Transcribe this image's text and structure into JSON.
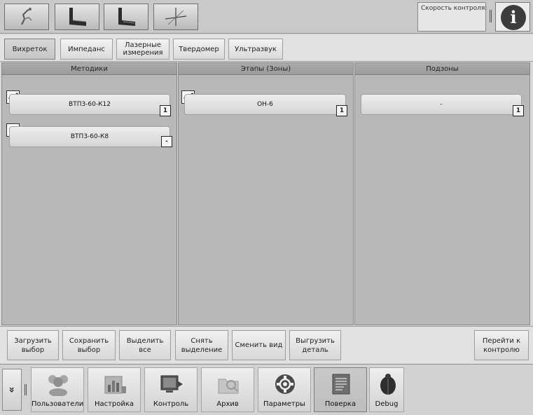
{
  "toolbar": {
    "tools": [
      {
        "icon": "probe-tool-icon"
      },
      {
        "icon": "dark-bracket-tool-icon"
      },
      {
        "icon": "dark-bracket-tool-2-icon"
      },
      {
        "icon": "crosshair-axes-icon"
      }
    ],
    "speed_label": "Скорость контроля:",
    "info_icon": "info-icon",
    "info_glyph": "i"
  },
  "tabs": [
    {
      "label": "Вихреток",
      "active": true
    },
    {
      "label": "Импеданс",
      "active": false
    },
    {
      "label": "Лазерные измерения",
      "active": false
    },
    {
      "label": "Твердомер",
      "active": false
    },
    {
      "label": "Ультразвук",
      "active": false
    }
  ],
  "columns": {
    "methods": {
      "header": "Методики",
      "items": [
        {
          "label": "ВТП3-60-К12",
          "checked": true,
          "count": "1"
        },
        {
          "label": "ВТП3-60-К8",
          "checked": false,
          "count": "-"
        }
      ]
    },
    "stages": {
      "header": "Этапы (Зоны)",
      "items": [
        {
          "label": "ОН-6",
          "checked": true,
          "count": "1"
        }
      ]
    },
    "subzones": {
      "header": "Подзоны",
      "items": [
        {
          "label": "-",
          "count": "1"
        }
      ]
    }
  },
  "actions": {
    "load": "Загрузить выбор",
    "save": "Сохранить выбор",
    "select_all": "Выделить все",
    "deselect": "Снять выделение",
    "change_view": "Сменить вид",
    "export": "Выгрузить деталь",
    "go_control": "Перейти к контролю"
  },
  "nav": {
    "collapse_glyph": "»",
    "items": [
      {
        "label": "Пользователи",
        "icon": "users-icon",
        "active": false
      },
      {
        "label": "Настройка",
        "icon": "settings-chart-icon",
        "active": false
      },
      {
        "label": "Контроль",
        "icon": "control-monitor-icon",
        "active": false
      },
      {
        "label": "Архив",
        "icon": "archive-folder-icon",
        "active": false
      },
      {
        "label": "Параметры",
        "icon": "gear-icon",
        "active": false
      },
      {
        "label": "Поверка",
        "icon": "verification-document-icon",
        "active": true
      },
      {
        "label": "Debug",
        "icon": "bug-icon",
        "active": false
      }
    ]
  },
  "colors": {
    "panel_bg": "#b8b8b8",
    "header_bg": "#9c9c9c",
    "info_circle": "#3c3c3c"
  }
}
